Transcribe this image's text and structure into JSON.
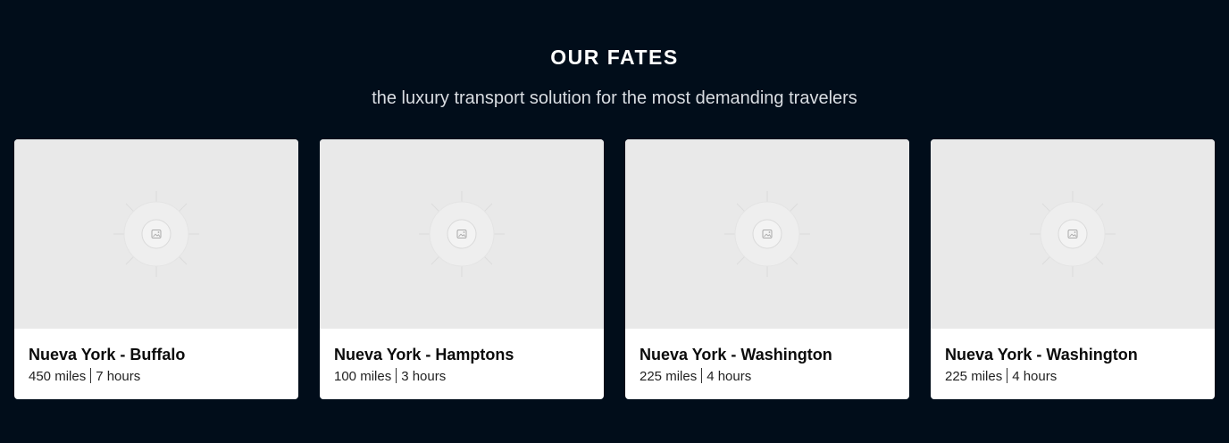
{
  "header": {
    "title": "OUR FATES",
    "subtitle": "the luxury transport solution for the most demanding travelers"
  },
  "cards": [
    {
      "title": "Nueva York - Buffalo",
      "distance": "450 miles",
      "duration": "7 hours",
      "image_icon": "image-placeholder-icon"
    },
    {
      "title": "Nueva York - Hamptons",
      "distance": "100 miles",
      "duration": "3 hours",
      "image_icon": "image-placeholder-icon"
    },
    {
      "title": "Nueva York - Washington",
      "distance": "225 miles",
      "duration": "4 hours",
      "image_icon": "image-placeholder-icon"
    },
    {
      "title": "Nueva York - Washington",
      "distance": "225 miles",
      "duration": "4 hours",
      "image_icon": "image-placeholder-icon"
    }
  ],
  "colors": {
    "background": "#010d1a",
    "card": "#ffffff",
    "placeholder": "#e9e9e9"
  }
}
